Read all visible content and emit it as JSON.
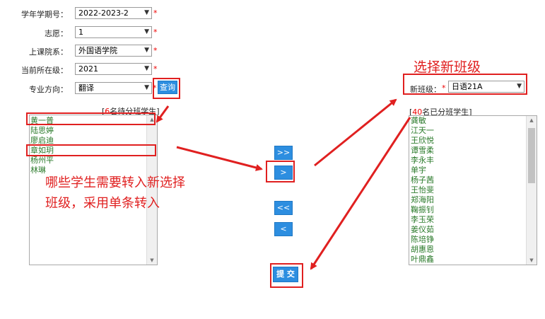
{
  "form": {
    "term_label": "学年学期号：",
    "term_value": "2022-2023-2",
    "wish_label": "志愿：",
    "wish_value": "1",
    "college_label": "上课院系：",
    "college_value": "外国语学院",
    "grade_label": "当前所在级：",
    "grade_value": "2021",
    "major_label": "专业方向：",
    "major_value": "翻译",
    "required_mark": "*",
    "query_button": "查询"
  },
  "left_panel": {
    "caption_prefix": "[",
    "caption_count": "6",
    "caption_suffix": "名待分班学生]",
    "students": [
      "黄一普",
      "陆思婷",
      "廖启迪",
      "章如玥",
      "杨州平",
      "林琳"
    ]
  },
  "transfer_buttons": {
    "move_all_right": ">>",
    "move_right": ">",
    "move_all_left": "<<",
    "move_left": "<",
    "submit": "提 交"
  },
  "right_panel": {
    "new_class_label": "新班级：",
    "new_class_value": "日语21A",
    "caption_prefix": "[",
    "caption_count": "40",
    "caption_suffix": "名已分班学生]",
    "students": [
      "龚敏",
      "江天一",
      "王欣悦",
      "谭雪柔",
      "李永丰",
      "单宇",
      "杨子茜",
      "王怡斐",
      "郑海阳",
      "鞠振钊",
      "李玉荣",
      "姜仪茹",
      "陈培铮",
      "胡惠恩",
      "叶鼎鑫"
    ]
  },
  "annotations": {
    "select_new_class": "选择新班级",
    "instruction_line1": "哪些学生需要转入新选择",
    "instruction_line2": "班级，采用单条转入"
  },
  "colors": {
    "button_blue": "#2d8ee0",
    "annotation_red": "#e02020",
    "student_green": "#2a7a2a"
  }
}
